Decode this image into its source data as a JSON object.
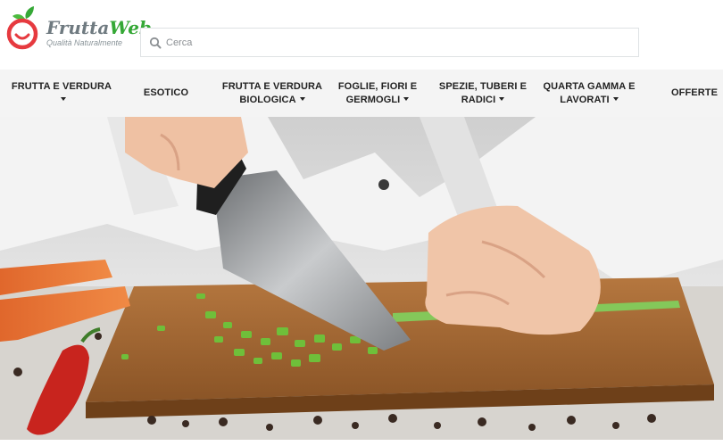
{
  "brand": {
    "name_part1": "Frutta",
    "name_part2": "Web",
    "tagline": "Qualità Naturalmente",
    "colors": {
      "red": "#e63a3f",
      "green": "#35a836",
      "grey": "#6f7a80"
    }
  },
  "search": {
    "placeholder": "Cerca",
    "value": ""
  },
  "nav": {
    "items": [
      {
        "line1": "FRUTTA E VERDURA",
        "line2": "",
        "has_dropdown": true
      },
      {
        "line1": "ESOTICO",
        "line2": "",
        "has_dropdown": false
      },
      {
        "line1": "FRUTTA E VERDURA",
        "line2": "BIOLOGICA",
        "has_dropdown": true
      },
      {
        "line1": "FOGLIE, FIORI E",
        "line2": "GERMOGLI",
        "has_dropdown": true
      },
      {
        "line1": "SPEZIE, TUBERI E",
        "line2": "RADICI",
        "has_dropdown": true
      },
      {
        "line1": "QUARTA GAMMA E",
        "line2": "LAVORATI",
        "has_dropdown": true
      },
      {
        "line1": "OFFERTE",
        "line2": "",
        "has_dropdown": false
      }
    ]
  },
  "hero": {
    "image_description_icon": "chef-cutting-vegetables-photo"
  }
}
